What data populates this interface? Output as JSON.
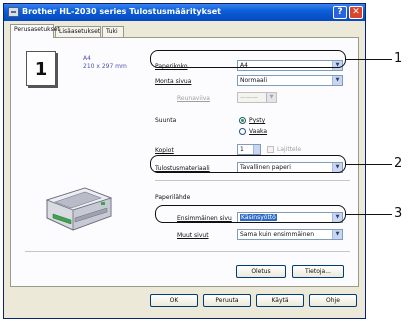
{
  "window": {
    "title": "Brother HL-2030 series Tulostusmääritykset",
    "help_glyph": "?",
    "close_glyph": "✕"
  },
  "tabs": [
    {
      "label": "Perusasetukset",
      "active": true
    },
    {
      "label": "Lisäasetukset",
      "active": false
    },
    {
      "label": "Tuki",
      "active": false
    }
  ],
  "preview": {
    "pages_number": "1",
    "paper_name": "A4",
    "paper_size": "210 x 297 mm"
  },
  "settings": {
    "paper_size_label": "Paperikoko",
    "paper_size_value": "A4",
    "multiple_pages_label": "Monta sivua",
    "multiple_pages_value": "Normaali",
    "border_label": "Reunaviiva",
    "border_value": "———",
    "orientation_label": "Suunta",
    "orientation_options": [
      {
        "label": "Pysty",
        "selected": true
      },
      {
        "label": "Vaaka",
        "selected": false
      }
    ],
    "copies_label": "Kopiot",
    "copies_value": "1",
    "collate_label": "Lajittele",
    "media_type_label": "Tulostusmateriaali",
    "media_type_value": "Tavallinen paperi",
    "paper_source_heading": "Paperilähde",
    "first_page_label": "Ensimmäinen sivu",
    "first_page_value": "Käsinsyöttö",
    "other_pages_label": "Muut sivut",
    "other_pages_value": "Sama kuin ensimmäinen"
  },
  "panel_buttons": {
    "default_label": "Oletus",
    "info_label": "Tietoja..."
  },
  "dialog_buttons": {
    "ok_label": "OK",
    "cancel_label": "Peruuta",
    "apply_label": "Käytä",
    "help_label": "Ohje"
  },
  "callouts": [
    "1",
    "2",
    "3"
  ],
  "icons": {
    "dropdown": "▼",
    "spin_up": "▲",
    "spin_down": "▼"
  }
}
